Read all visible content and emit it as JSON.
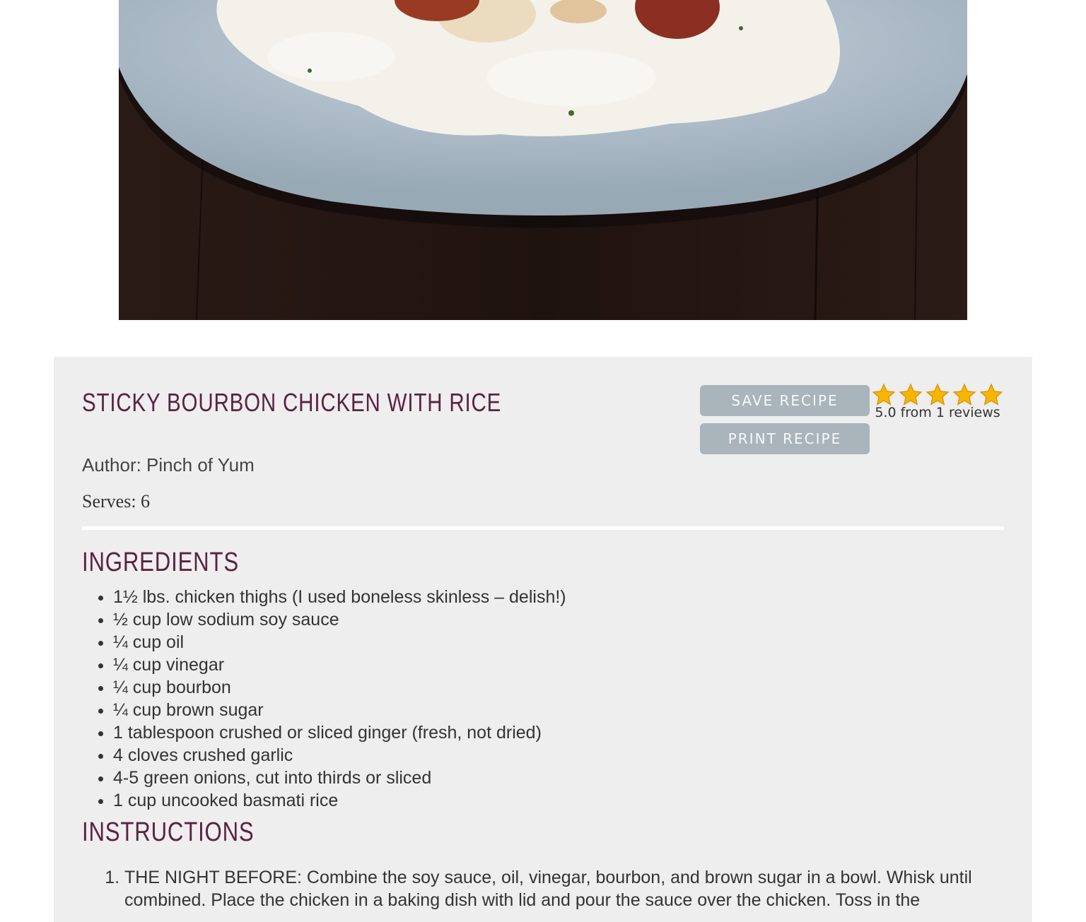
{
  "recipe": {
    "title": "STICKY BOURBON CHICKEN WITH RICE",
    "author": "Author: Pinch of Yum",
    "serves": "Serves: 6"
  },
  "buttons": {
    "save": "SAVE RECIPE",
    "print": "PRINT RECIPE"
  },
  "rating": {
    "stars": 5,
    "text": "5.0 from 1 reviews"
  },
  "ingredients": {
    "heading": "INGREDIENTS",
    "items": [
      "1½ lbs. chicken thighs (I used boneless skinless – delish!)",
      "½ cup low sodium soy sauce",
      "¼ cup oil",
      "¼ cup vinegar",
      "¼ cup bourbon",
      "¼ cup brown sugar",
      "1 tablespoon crushed or sliced ginger (fresh, not dried)",
      "4 cloves crushed garlic",
      "4-5 green onions, cut into thirds or sliced",
      "1 cup uncooked basmati rice"
    ]
  },
  "instructions": {
    "heading": "INSTRUCTIONS",
    "steps": [
      "THE NIGHT BEFORE: Combine the soy sauce, oil, vinegar, bourbon, and brown sugar in a bowl. Whisk until combined. Place the chicken in a baking dish with lid and pour the sauce over the chicken. Toss in the"
    ]
  },
  "colors": {
    "heading": "#5a2340",
    "button": "#a9b5bb",
    "card_background": "#eeeeee",
    "star": "#f7b500"
  }
}
